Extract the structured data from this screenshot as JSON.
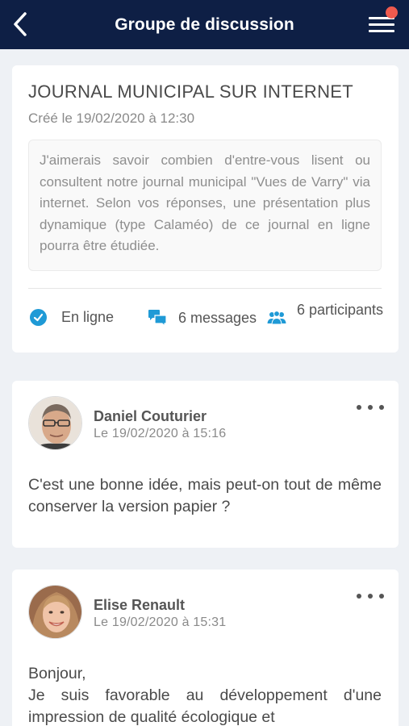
{
  "header": {
    "title": "Groupe de discussion",
    "back_icon": "chevron-left-icon",
    "menu_icon": "hamburger-menu-icon",
    "has_notification": true,
    "colors": {
      "background": "#0e1f45",
      "notification": "#ef5a4e"
    }
  },
  "group": {
    "title": "JOURNAL MUNICIPAL SUR INTERNET",
    "created": "Créé le 19/02/2020 à 12:30",
    "description": "J'aimerais savoir combien d'entre-vous lisent ou consultent notre journal municipal \"Vues de Varry\" via internet. Selon vos réponses, une présentation plus dynamique (type Calaméo) de ce journal en ligne pourra être étudiée.",
    "stats": {
      "status": "En ligne",
      "messages": "6 messages",
      "participants": "6 participants"
    },
    "accent_color": "#1f9ad6"
  },
  "messages": [
    {
      "author": "Daniel Couturier",
      "date": "Le 19/02/2020 à 15:16",
      "body": "C'est une bonne idée, mais peut-on tout de même conserver la version papier ?"
    },
    {
      "author": "Elise Renault",
      "date": "Le 19/02/2020 à 15:31",
      "body_line1": "Bonjour,",
      "body": "Je suis favorable au développement d'une impression de qualité écologique et"
    }
  ]
}
